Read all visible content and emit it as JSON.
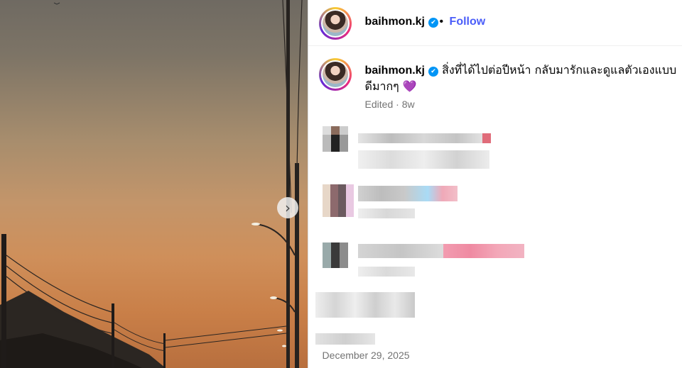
{
  "post": {
    "username": "baihmon.kj",
    "verified_mark": "✔",
    "separator": "•",
    "follow_label": "Follow",
    "caption": "สิ่งที่ได้ไปต่อปีหน้า กลับมารักและดูแลตัวเองแบบดีมากๆ 💜",
    "edited_label": "Edited",
    "time_ago": "8w",
    "date": "December 29, 2025"
  },
  "icons": {
    "next": "chevron-right-icon",
    "verified": "verified-badge-icon",
    "emoji": "purple-heart-icon"
  },
  "colors": {
    "follow": "#4a5df9",
    "verified": "#0095f6",
    "muted": "#737373"
  },
  "nav": {
    "next_glyph": "›"
  },
  "comments_note": "",
  "comments": []
}
